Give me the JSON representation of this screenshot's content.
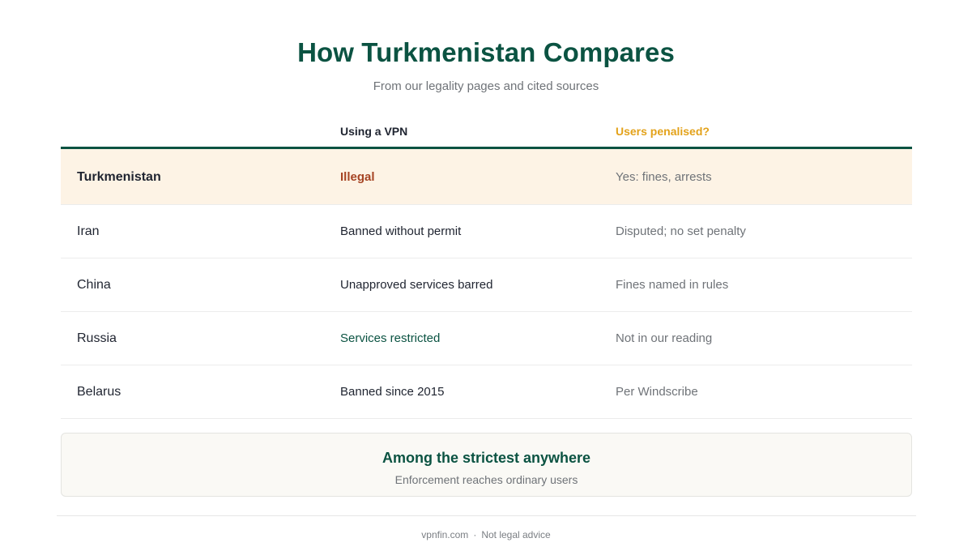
{
  "header": {
    "title": "How Turkmenistan Compares",
    "subtitle": "From our legality pages and cited sources"
  },
  "table": {
    "columns": [
      "",
      "Using a VPN",
      "Users penalised?"
    ],
    "rows": [
      {
        "country": "Turkmenistan",
        "vpn_status": "Illegal",
        "penalty": "Yes: fines, arrests",
        "highlight": true
      },
      {
        "country": "Iran",
        "vpn_status": "Banned without permit",
        "penalty": "Disputed; no set penalty"
      },
      {
        "country": "China",
        "vpn_status": "Unapproved services barred",
        "penalty": "Fines named in rules"
      },
      {
        "country": "Russia",
        "vpn_status": "Services restricted",
        "penalty": "Not in our reading"
      },
      {
        "country": "Belarus",
        "vpn_status": "Banned since 2015",
        "penalty": "Per Windscribe"
      }
    ]
  },
  "callout": {
    "title": "Among the strictest anywhere",
    "subtitle": "Enforcement reaches ordinary users"
  },
  "footer": {
    "site": "vpnfin.com",
    "separator": "·",
    "note": "Not legal advice"
  },
  "colors": {
    "brand_green": "#0b5342",
    "accent_amber": "#e3a21a",
    "illegal_red": "#a64424",
    "highlight_bg": "#fdf3e5"
  }
}
